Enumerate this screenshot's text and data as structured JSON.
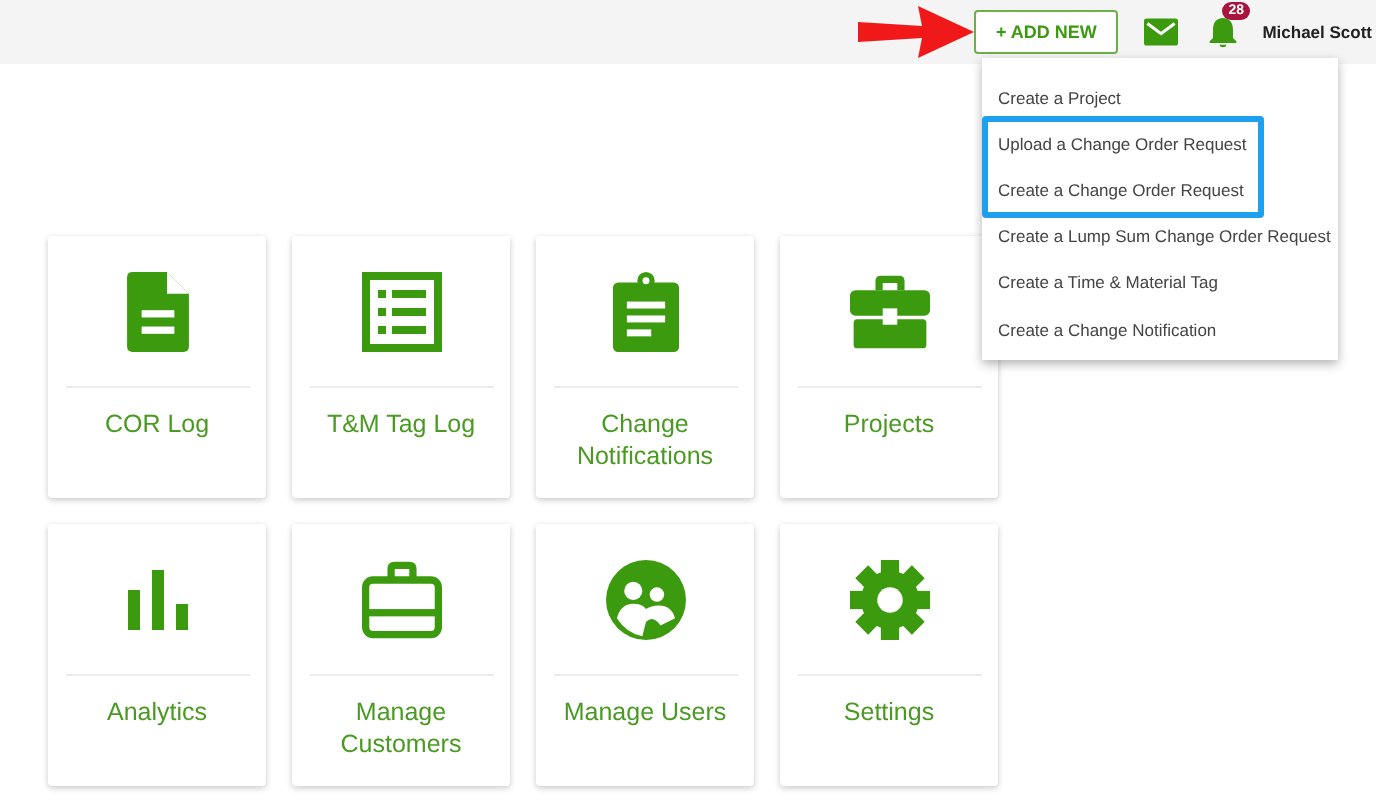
{
  "topbar": {
    "add_button": "+ ADD NEW",
    "notification_count": "28",
    "user_name": "Michael Scott"
  },
  "menu": {
    "items": [
      {
        "label": "Create a Project",
        "highlighted": false
      },
      {
        "label": "Upload a Change Order Request",
        "highlighted": true
      },
      {
        "label": "Create a Change Order Request",
        "highlighted": true
      },
      {
        "label": "Create a Lump Sum Change Order Request",
        "highlighted": false
      },
      {
        "label": "Create a Time & Material Tag",
        "highlighted": false
      },
      {
        "label": "Create a Change Notification",
        "highlighted": false
      }
    ]
  },
  "tiles": [
    {
      "label": "COR Log"
    },
    {
      "label": "T&M Tag Log"
    },
    {
      "label": "Change Notifications"
    },
    {
      "label": "Projects"
    },
    {
      "label": "Analytics"
    },
    {
      "label": "Manage Customers"
    },
    {
      "label": "Manage Users"
    },
    {
      "label": "Settings"
    }
  ]
}
